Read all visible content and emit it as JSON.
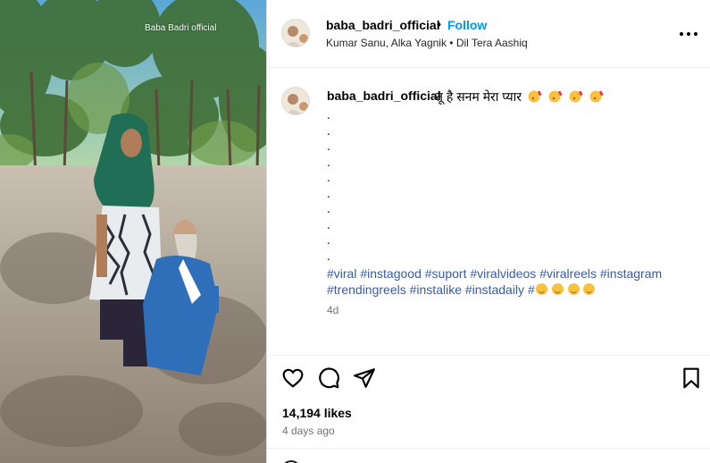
{
  "media": {
    "watermark": "Baba Badri official"
  },
  "header": {
    "username": "baba_badri_official",
    "separator": "•",
    "follow_label": "Follow",
    "audio": "Kumar Sanu, Alka Yagnik • Dil Tera Aashiq"
  },
  "caption": {
    "username": "baba_badri_official",
    "text": "तू है सनम मेरा प्यार",
    "dots": [
      ".",
      ".",
      ".",
      ".",
      ".",
      ".",
      ".",
      ".",
      ".",
      "."
    ],
    "hashtags": [
      "#viral",
      "#instagood",
      "#suport",
      "#viralvideos",
      "#viralreels",
      "#instagram",
      "#trendingreels",
      "#instalike",
      "#instadaily",
      "#"
    ],
    "time": "4d"
  },
  "stats": {
    "likes": "14,194 likes",
    "posted": "4 days ago"
  },
  "icons": [
    "heart-icon",
    "comment-icon",
    "share-icon",
    "bookmark-icon",
    "more-icon",
    "kiss-emoji",
    "smile-emoji"
  ]
}
